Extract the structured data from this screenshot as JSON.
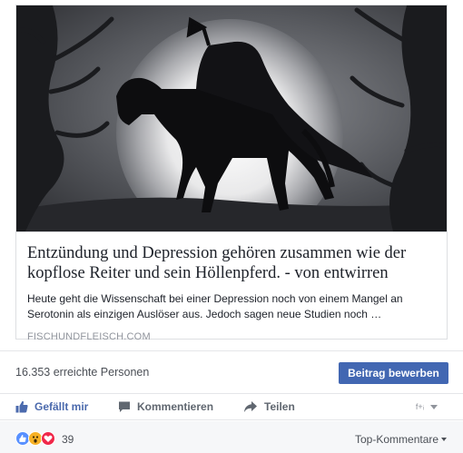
{
  "link_preview": {
    "title": "Entzündung und Depression gehören zusammen wie der kopflose Reiter und sein Höllenpferd. - von entwirren",
    "description": "Heute geht die Wissenschaft bei einer Depression noch von einem Mangel an Serotonin als einzigen Auslöser aus. Jedoch sagen neue Studien noch …",
    "domain": "FISCHUNDFLEISCH.COM"
  },
  "insights": {
    "reach_text": "16.353 erreichte Personen",
    "boost_label": "Beitrag bewerben"
  },
  "actions": {
    "like_label": "Gefällt mir",
    "comment_label": "Kommentieren",
    "share_label": "Teilen"
  },
  "reactions": {
    "count": "39",
    "sort_label": "Top-Kommentare",
    "icons": [
      "like-reaction-icon",
      "wow-reaction-icon",
      "love-reaction-icon"
    ]
  },
  "colors": {
    "brand_blue": "#4267b2",
    "like_blue": "#4b6aad",
    "love_red": "#f0284a",
    "wow_yellow": "#f7b125"
  }
}
